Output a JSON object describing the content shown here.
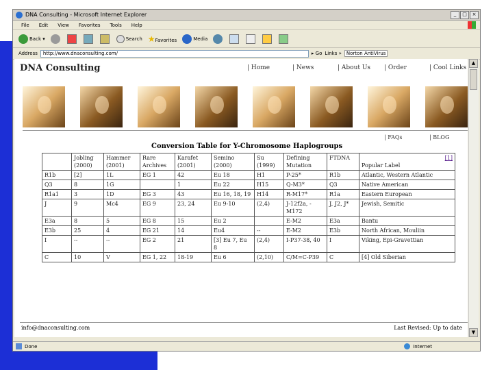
{
  "window": {
    "title": "DNA Consulting - Microsoft Internet Explorer"
  },
  "menu": [
    "File",
    "Edit",
    "View",
    "Favorites",
    "Tools",
    "Help"
  ],
  "toolbar": {
    "back": "Back",
    "search": "Search",
    "favorites": "Favorites",
    "media": "Media"
  },
  "address": {
    "label": "Address",
    "value": "http://www.dnaconsulting.com/",
    "go": "Go",
    "links": "Links »",
    "norton": "Norton AntiVirus"
  },
  "page": {
    "logo": "DNA Consulting",
    "nav": [
      "| Home",
      "| News",
      "| About Us",
      "| Order",
      "| Cool Links"
    ],
    "subnav": [
      "| FAQs",
      "| BLOG"
    ],
    "table_title": "Conversion Table for Y-Chromosome Haplogroups",
    "headers": [
      "",
      "Jobling (2000)",
      "Hammer (2001)",
      "Rare Archives",
      "Karafet (2001)",
      "Semino (2000)",
      "Su (1999)",
      "Defining Mutation",
      "FTDNA",
      "Popular Label"
    ],
    "header_ref": "[1]",
    "rows": [
      [
        "R1b",
        "[2]",
        "1L",
        "EG 1",
        "42",
        "Eu 18",
        "H1",
        "P-25*",
        "R1b",
        "Atlantic, Western Atlantic"
      ],
      [
        "Q3",
        "8",
        "1G",
        "",
        "1",
        "Eu 22",
        "H15",
        "Q-M3*",
        "Q3",
        "Native American"
      ],
      [
        "R1a1",
        "3",
        "1D",
        "EG 3",
        "43",
        "Eu 16, 18, 19",
        "H14",
        "R-M17*",
        "R1a",
        "Eastern European"
      ],
      [
        "J",
        "9",
        "Mc4",
        "EG 9",
        "23, 24",
        "Eu 9-10",
        "(2,4)",
        "J-12f2a, -M172",
        "J, J2, J*",
        "Jewish, Semitic"
      ],
      [
        "E3a",
        "8",
        "5",
        "EG 8",
        "15",
        "Eu 2",
        "",
        "E-M2",
        "E3a",
        "Bantu"
      ],
      [
        "E3b",
        "25",
        "4",
        "EG 21",
        "14",
        "Eu4",
        "--",
        "E-M2",
        "E3b",
        "North African, Mouliin"
      ],
      [
        "I",
        "--",
        "--",
        "EG 2",
        "21",
        "[3] Eu 7, Eu 8",
        "(2,4)",
        "I-P37-38, 40",
        "I",
        "Viking, Epi-Gravettian"
      ],
      [
        "C",
        "10",
        "V",
        "EG 1, 22",
        "18-19",
        "Eu 6",
        "(2,10)",
        "C/M=C-P39",
        "C",
        "[4] Old Siberian"
      ]
    ],
    "footer_left": "info@dnaconsulting.com",
    "footer_right": "Last Revised: Up to date"
  },
  "status": {
    "left": "Done",
    "zone": "Internet"
  },
  "colors": {
    "slide_bar": "#1c2fd6",
    "chrome": "#ece9d8"
  }
}
